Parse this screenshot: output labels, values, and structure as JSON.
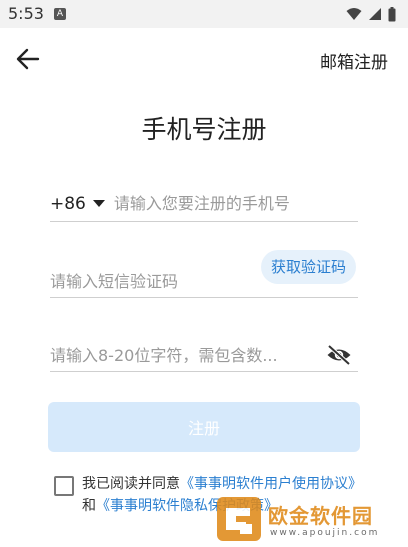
{
  "status_bar": {
    "time": "5:53",
    "notification_badge": "A"
  },
  "header": {
    "back_icon": "arrow-left-icon",
    "email_register_label": "邮箱注册"
  },
  "page": {
    "title": "手机号注册"
  },
  "form": {
    "country_code": "+86",
    "phone_placeholder": "请输入您要注册的手机号",
    "code_placeholder": "请输入短信验证码",
    "get_code_label": "获取验证码",
    "password_placeholder": "请输入8-20位字符，需包含数...",
    "visibility_icon": "eye-off-icon",
    "register_label": "注册"
  },
  "agreement": {
    "prefix": "我已阅读并同意",
    "user_agreement_link": "《事事明软件用户使用协议》",
    "conjunction": "和",
    "privacy_link": "《事事明软件隐私保护政策》"
  },
  "watermark": {
    "title": "欧金软件园",
    "url": "www.apoujin.com"
  },
  "colors": {
    "accent": "#2b7fd0",
    "button_disabled": "#d6e9fb",
    "chip_bg": "#e6f1fb",
    "watermark_orange": "#e08a1a"
  }
}
